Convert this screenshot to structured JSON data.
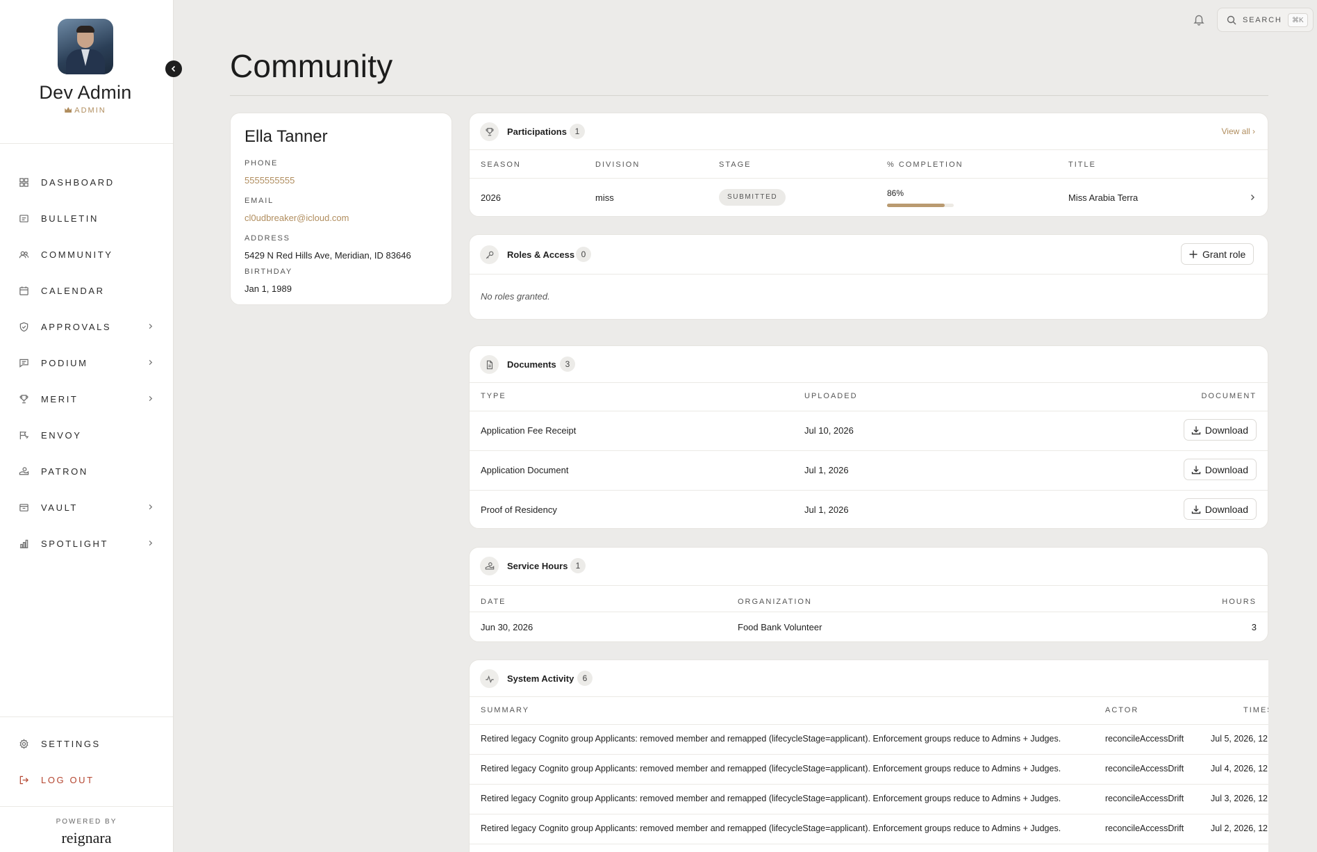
{
  "profile": {
    "name": "Dev Admin",
    "role": "ADMIN"
  },
  "nav": {
    "items": [
      {
        "label": "DASHBOARD",
        "icon": "dashboard-icon",
        "has_chevron": false
      },
      {
        "label": "BULLETIN",
        "icon": "bulletin-icon",
        "has_chevron": false
      },
      {
        "label": "COMMUNITY",
        "icon": "community-icon",
        "has_chevron": false
      },
      {
        "label": "CALENDAR",
        "icon": "calendar-icon",
        "has_chevron": false
      },
      {
        "label": "APPROVALS",
        "icon": "shield-check-icon",
        "has_chevron": true
      },
      {
        "label": "PODIUM",
        "icon": "podium-icon",
        "has_chevron": true
      },
      {
        "label": "MERIT",
        "icon": "trophy-icon",
        "has_chevron": true
      },
      {
        "label": "ENVOY",
        "icon": "envoy-icon",
        "has_chevron": false
      },
      {
        "label": "PATRON",
        "icon": "patron-icon",
        "has_chevron": false
      },
      {
        "label": "VAULT",
        "icon": "vault-icon",
        "has_chevron": true
      },
      {
        "label": "SPOTLIGHT",
        "icon": "bar-chart-icon",
        "has_chevron": true
      }
    ],
    "settings_label": "SETTINGS",
    "logout_label": "LOG OUT"
  },
  "footer": {
    "powered_by": "POWERED BY",
    "brand": "reignara"
  },
  "topbar": {
    "search_label": "SEARCH",
    "search_shortcut": "⌘K"
  },
  "page": {
    "title": "Community"
  },
  "contact": {
    "name": "Ella Tanner",
    "phone_label": "PHONE",
    "phone": "5555555555",
    "email_label": "EMAIL",
    "email": "cl0udbreaker@icloud.com",
    "address_label": "ADDRESS",
    "address": "5429 N Red Hills Ave, Meridian, ID 83646",
    "birthday_label": "BIRTHDAY",
    "birthday": "Jan 1, 1989"
  },
  "participations": {
    "title": "Participations",
    "count": "1",
    "view_all": "View all",
    "headers": [
      "SEASON",
      "DIVISION",
      "STAGE",
      "% COMPLETION",
      "TITLE"
    ],
    "rows": [
      {
        "season": "2026",
        "division": "miss",
        "stage": "SUBMITTED",
        "completion_label": "86%",
        "completion": 0.86,
        "title": "Miss Arabia Terra"
      }
    ]
  },
  "roles": {
    "title": "Roles & Access",
    "count": "0",
    "grant_label": "Grant role",
    "empty": "No roles granted."
  },
  "documents": {
    "title": "Documents",
    "count": "3",
    "headers": [
      "TYPE",
      "UPLOADED",
      "DOCUMENT"
    ],
    "download_label": "Download",
    "rows": [
      {
        "type": "Application Fee Receipt",
        "uploaded": "Jul 10, 2026"
      },
      {
        "type": "Application Document",
        "uploaded": "Jul 1, 2026"
      },
      {
        "type": "Proof of Residency",
        "uploaded": "Jul 1, 2026"
      }
    ]
  },
  "service": {
    "title": "Service Hours",
    "count": "1",
    "headers": [
      "DATE",
      "ORGANIZATION",
      "HOURS"
    ],
    "rows": [
      {
        "date": "Jun 30, 2026",
        "organization": "Food Bank Volunteer",
        "hours": "3"
      }
    ]
  },
  "activity": {
    "title": "System Activity",
    "count": "6",
    "headers": [
      "SUMMARY",
      "ACTOR",
      "TIMES"
    ],
    "rows": [
      {
        "summary": "Retired legacy Cognito group Applicants: removed member and remapped (lifecycleStage=applicant). Enforcement groups reduce to Admins + Judges.",
        "actor": "reconcileAccessDrift",
        "time": "Jul 5, 2026, 12"
      },
      {
        "summary": "Retired legacy Cognito group Applicants: removed member and remapped (lifecycleStage=applicant). Enforcement groups reduce to Admins + Judges.",
        "actor": "reconcileAccessDrift",
        "time": "Jul 4, 2026, 12"
      },
      {
        "summary": "Retired legacy Cognito group Applicants: removed member and remapped (lifecycleStage=applicant). Enforcement groups reduce to Admins + Judges.",
        "actor": "reconcileAccessDrift",
        "time": "Jul 3, 2026, 12"
      },
      {
        "summary": "Retired legacy Cognito group Applicants: removed member and remapped (lifecycleStage=applicant). Enforcement groups reduce to Admins + Judges.",
        "actor": "reconcileAccessDrift",
        "time": "Jul 2, 2026, 12"
      }
    ]
  },
  "colors": {
    "accent": "#b08d5e",
    "logout": "#b4452f",
    "background": "#ecebe9"
  }
}
